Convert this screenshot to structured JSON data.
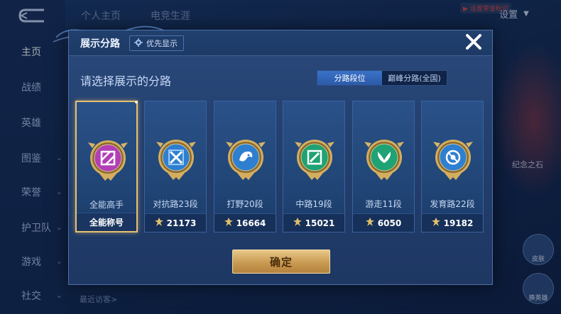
{
  "background": {
    "sidebar": [
      {
        "label": "主页",
        "active": true,
        "chevron": false
      },
      {
        "label": "战绩",
        "active": false,
        "chevron": false
      },
      {
        "label": "英雄",
        "active": false,
        "chevron": false
      },
      {
        "label": "图鉴",
        "active": false,
        "chevron": true
      },
      {
        "label": "荣誉",
        "active": false,
        "chevron": true
      },
      {
        "label": "护卫队",
        "active": false,
        "chevron": true
      },
      {
        "label": "游戏",
        "active": false,
        "chevron": true
      },
      {
        "label": "社交",
        "active": false,
        "chevron": true
      }
    ],
    "tabs": [
      "个人主页",
      "电竞生涯"
    ],
    "settings_label": "设置",
    "badge_text": "▶ 设置荣誉标识",
    "right_text": "纪念之石",
    "right_buttons": [
      "皮肤",
      "换英雄"
    ],
    "recent_visitors": "最近访客>"
  },
  "dialog": {
    "title": "展示分路",
    "priority_label": "优先显示",
    "subtitle": "请选择展示的分路",
    "toggle_options": [
      {
        "label": "分路段位",
        "selected": true
      },
      {
        "label": "巅峰分路(全国)",
        "selected": false
      }
    ],
    "cards": [
      {
        "name": "全能高手",
        "stat": "全能称号",
        "has_icon": false,
        "selected": true,
        "medal_color": "#b23fb6",
        "medal_icon": "grid-emblem-icon"
      },
      {
        "name": "对抗路23段",
        "stat": "21173",
        "has_icon": true,
        "selected": false,
        "medal_color": "#2f7fd0",
        "medal_icon": "crossed-swords-icon"
      },
      {
        "name": "打野20段",
        "stat": "16664",
        "has_icon": true,
        "selected": false,
        "medal_color": "#2f7fd0",
        "medal_icon": "beast-head-icon"
      },
      {
        "name": "中路19段",
        "stat": "15021",
        "has_icon": true,
        "selected": false,
        "medal_color": "#1fa274",
        "medal_icon": "wand-icon"
      },
      {
        "name": "游走11段",
        "stat": "6050",
        "has_icon": true,
        "selected": false,
        "medal_color": "#1fa274",
        "medal_icon": "wings-icon"
      },
      {
        "name": "发育路22段",
        "stat": "19182",
        "has_icon": true,
        "selected": false,
        "medal_color": "#2f7fd0",
        "medal_icon": "target-icon"
      }
    ],
    "confirm_label": "确定",
    "close_icon": "close-icon"
  },
  "colors": {
    "gold_accent": "#e6c170",
    "confirm_gold": "#c99a52",
    "toggle_active": "#3b72c8",
    "card_bg": "#214677"
  }
}
